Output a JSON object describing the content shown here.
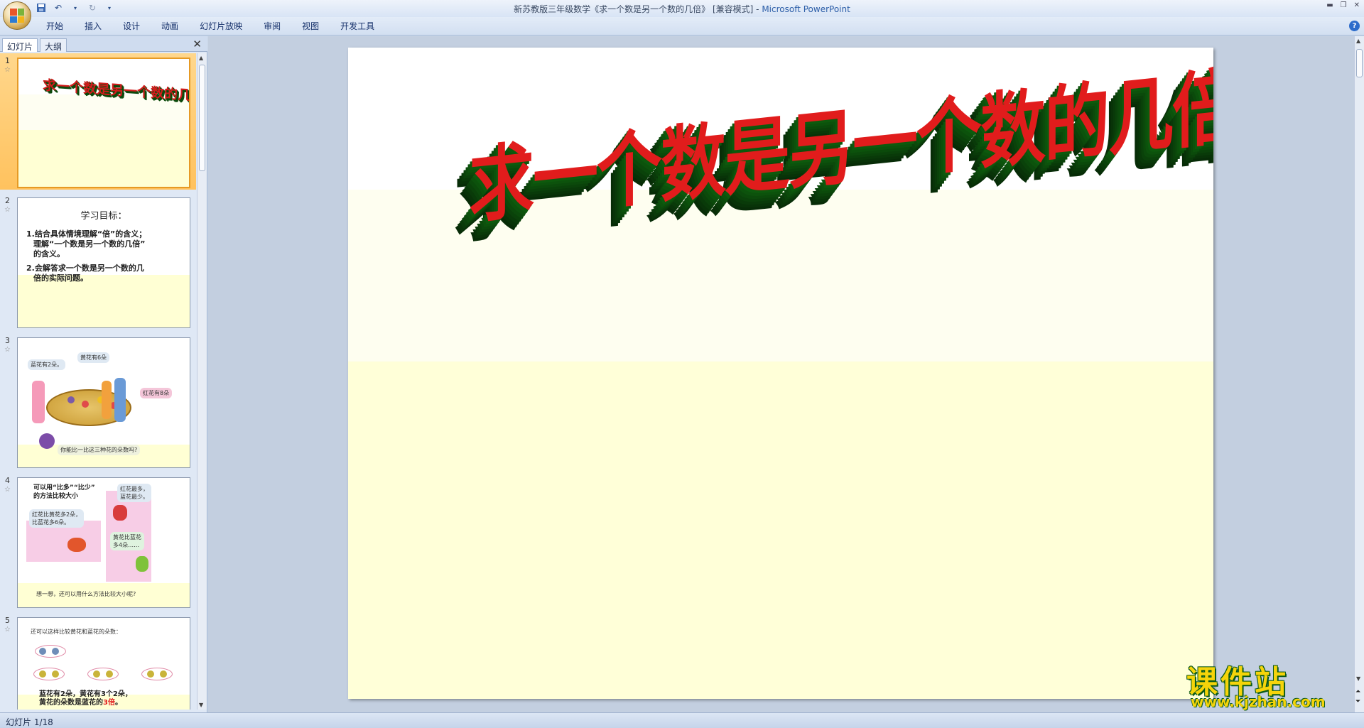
{
  "window": {
    "title": "新苏教版三年级数学《求一个数是另一个数的几倍》 [兼容模式] - ",
    "app_name": "Microsoft PowerPoint"
  },
  "ribbon": {
    "tabs": [
      "开始",
      "插入",
      "设计",
      "动画",
      "幻灯片放映",
      "审阅",
      "视图",
      "开发工具"
    ]
  },
  "left_pane": {
    "tabs": [
      "幻灯片",
      "大纲"
    ],
    "close_symbol": "✕"
  },
  "thumbnails": [
    {
      "num": "1",
      "title": "求一个数是另一个数的几倍"
    },
    {
      "num": "2",
      "heading": "学习目标：",
      "lines": [
        "1.结合具体情境理解“倍”的含义；",
        "理解“一个数是另一个数的几倍”",
        "的含义。",
        "2.会解答求一个数是另一个数的几",
        "倍的实际问题。"
      ]
    },
    {
      "num": "3",
      "bubbles": [
        "蓝花有2朵。",
        "黄花有6朵",
        "红花有8朵"
      ],
      "question": "你能比一比这三种花的朵数吗?"
    },
    {
      "num": "4",
      "lines": [
        "可以用“比多”“比少”",
        "的方法比较大小"
      ],
      "b1": "红花比黄花多2朵，",
      "b1b": "比蓝花多6朵。",
      "b2": "红花最多，",
      "b2b": "蓝花最少。",
      "b3": "黄花比蓝花",
      "b3b": "多4朵……",
      "footer": "想一想，还可以用什么方法比较大小呢?"
    },
    {
      "num": "5",
      "line1": "还可以这样比较黄花和蓝花的朵数：",
      "line2": "蓝花有2朵，黄花有3个2朵，",
      "line3a": "黄花的朵数是蓝花的",
      "line3b": "3倍",
      "line3c": "。"
    }
  ],
  "slide": {
    "title": "求一个数是另一个数的几倍"
  },
  "watermark": {
    "cn": "课件站",
    "url": "www.kjzhan.com"
  },
  "status": {
    "slide_indicator": "幻灯片 1/18"
  },
  "colors": {
    "title_red": "#e11c1c",
    "title_green": "#0b4a0b",
    "selected_thumb": "#ffc25e",
    "slide_band_yellow": "#ffffd8"
  }
}
